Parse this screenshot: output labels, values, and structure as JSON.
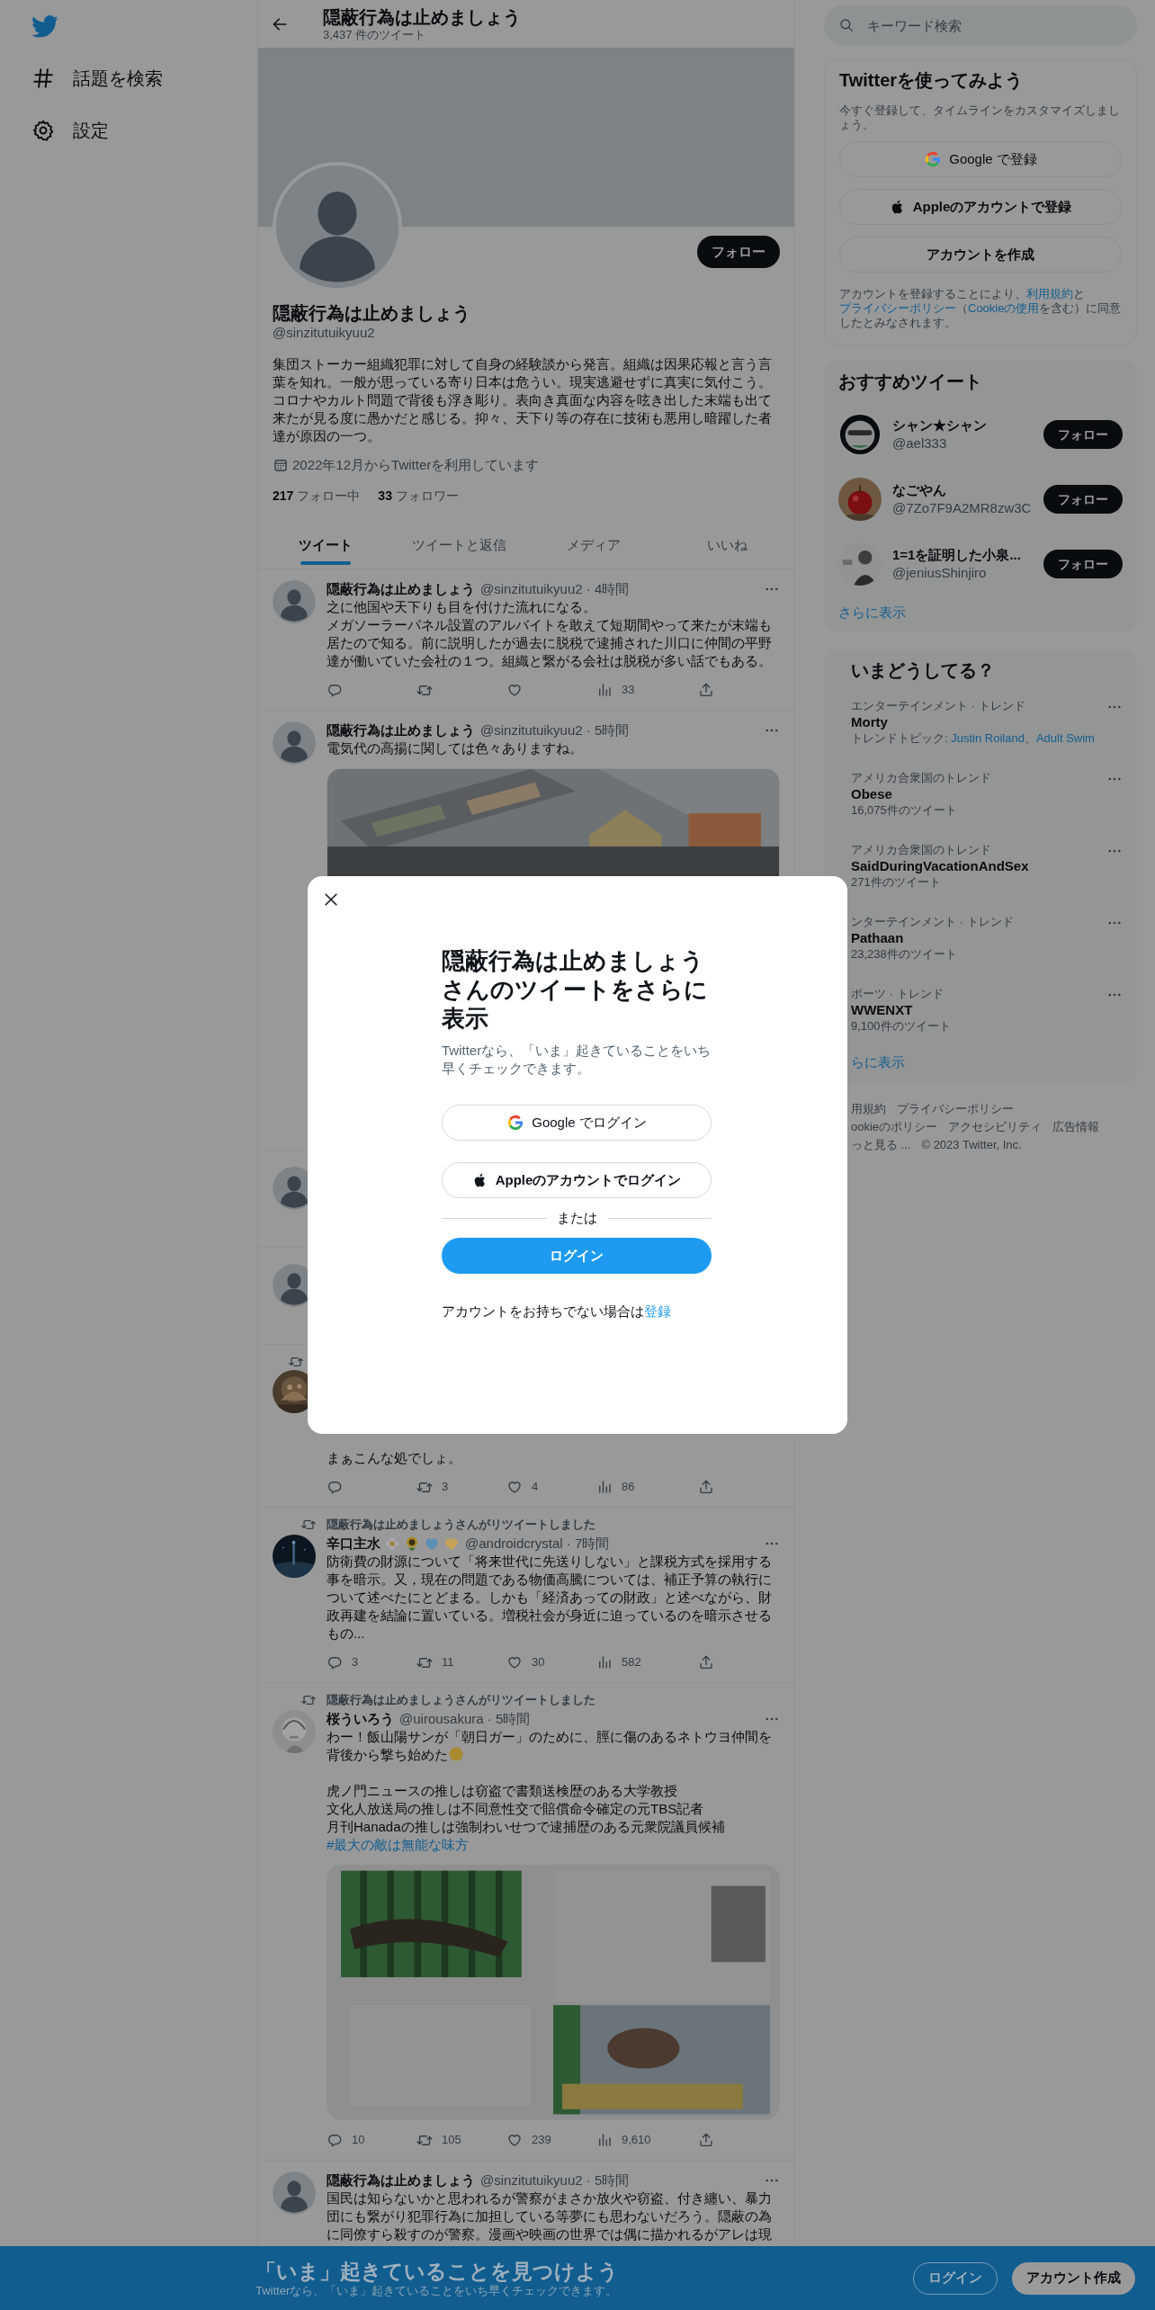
{
  "nav": {
    "items": [
      {
        "label": "話題を検索"
      },
      {
        "label": "設定"
      }
    ]
  },
  "profile_header": {
    "title": "隠蔽行為は止めましょう",
    "subtitle": "3,437 件のツイート"
  },
  "profile": {
    "follow_button": "フォロー",
    "name": "隠蔽行為は止めましょう",
    "handle": "@sinzitutuikyuu2",
    "bio": "集団ストーカー組織犯罪に対して自身の経験談から発言。組織は因果応報と言う言葉を知れ。一般が思っている寄り日本は危うい。現実逃避せずに真実に気付こう。コロナやカルト問題で背後も浮き彫り。表向き真面な内容を呟き出した末端も出て来たが見る度に愚かだと感じる。抑々、天下り等の存在に技術も悪用し暗躍した者達が原因の一つ。",
    "joined": "2022年12月からTwitterを利用しています",
    "following_count": "217",
    "following_label": "フォロー中",
    "followers_count": "33",
    "followers_label": "フォロワー"
  },
  "tabs": [
    {
      "label": "ツイート",
      "selected": true
    },
    {
      "label": "ツイートと返信",
      "selected": false
    },
    {
      "label": "メディア",
      "selected": false
    },
    {
      "label": "いいね",
      "selected": false
    }
  ],
  "tweets": [
    {
      "kind": "tweet",
      "name": "隠蔽行為は止めましょう",
      "meta": "@sinzitutuikyuu2 · 4時間",
      "body": [
        {
          "kind": "text",
          "text": "之に他国や天下りも目を付けた流れになる。"
        },
        {
          "kind": "break"
        },
        {
          "kind": "text",
          "text": "メガソーラーパネル設置のアルバイトを敢えて短期間やって来たが末端も居たので知る。前に説明したが過去に脱税で逮捕された川口に仲間の平野達が働いていた会社の１つ。組織と繋がる会社は脱税が多い話でもある。"
        }
      ],
      "actions": [
        {
          "kind": "reply"
        },
        {
          "kind": "retweet"
        },
        {
          "kind": "like"
        },
        {
          "kind": "views",
          "count": "33"
        },
        {
          "kind": "share"
        }
      ]
    },
    {
      "kind": "tweet",
      "name": "隠蔽行為は止めましょう",
      "meta": "@sinzitutuikyuu2 · 5時間",
      "body": [
        {
          "kind": "text",
          "text": "電気代の高揚に関しては色々ありますね。"
        }
      ],
      "media": {
        "kind": "picture"
      }
    },
    {
      "kind": "covered"
    },
    {
      "kind": "covered"
    },
    {
      "kind": "partial",
      "body": [
        {
          "kind": "text",
          "text": "まぁこんな処でしょ。"
        }
      ],
      "actions": [
        {
          "kind": "reply"
        },
        {
          "kind": "retweet",
          "count": "3"
        },
        {
          "kind": "like",
          "count": "4"
        },
        {
          "kind": "views",
          "count": "86"
        },
        {
          "kind": "share"
        }
      ]
    },
    {
      "kind": "tweet",
      "retweeted_by": "隠蔽行為は止めましょうさんがリツイートしました",
      "name": "辛口主水",
      "badges": [
        {
          "kind": "flower"
        },
        {
          "kind": "sunflower"
        },
        {
          "kind": "heart",
          "color": "#5b8fb5"
        },
        {
          "kind": "heart",
          "color": "#c9a35a"
        }
      ],
      "meta": "@androidcrystal · 7時間",
      "body": [
        {
          "kind": "text",
          "text": "防衛費の財源について「将来世代に先送りしない」と課税方式を採用する事を暗示。又，現在の問題である物価高騰については、補正予算の執行について述べたにとどまる。しかも「経済あっての財政」と述べながら、財政再建を結論に置いている。増税社会が身近に迫っているのを暗示させるもの..."
        }
      ],
      "actions": [
        {
          "kind": "reply",
          "count": "3"
        },
        {
          "kind": "retweet",
          "count": "11"
        },
        {
          "kind": "like",
          "count": "30"
        },
        {
          "kind": "views",
          "count": "582"
        },
        {
          "kind": "share"
        }
      ]
    },
    {
      "kind": "tweet",
      "retweeted_by": "隠蔽行為は止めましょうさんがリツイートしました",
      "name": "桜ういろう",
      "meta": "@uirousakura · 5時間",
      "body": [
        {
          "kind": "text",
          "text": "わー！飯山陽サンが「朝日ガー」のために、脛に傷のあるネトウヨ仲間を背後から撃ち始めた"
        },
        {
          "kind": "emoji"
        },
        {
          "kind": "break"
        },
        {
          "kind": "break"
        },
        {
          "kind": "text",
          "text": "虎ノ門ニュースの推しは窃盗で書類送検歴のある大学教授"
        },
        {
          "kind": "break"
        },
        {
          "kind": "text",
          "text": "文化人放送局の推しは不同意性交で賠償命令確定の元TBS記者"
        },
        {
          "kind": "break"
        },
        {
          "kind": "text",
          "text": "月刊Hanadaの推しは強制わいせつで逮捕歴のある元衆院議員候補"
        },
        {
          "kind": "break"
        },
        {
          "kind": "hashtag",
          "text": "#最大の敵は無能な味方"
        }
      ],
      "media": {
        "kind": "picture"
      },
      "actions": [
        {
          "kind": "reply",
          "count": "10"
        },
        {
          "kind": "retweet",
          "count": "105"
        },
        {
          "kind": "like",
          "count": "239"
        },
        {
          "kind": "views",
          "count": "9,610"
        },
        {
          "kind": "share"
        }
      ]
    },
    {
      "kind": "tweet",
      "name": "隠蔽行為は止めましょう",
      "meta": "@sinzitutuikyuu2 · 5時間",
      "body": [
        {
          "kind": "text",
          "text": "国民は知らないかと思われるが警察がまさか放火や窃盗、付き纏い、暴力団にも繋がり犯罪行為に加担している等夢にも思わないだろう。隠蔽の為に同僚すら殺すのが警察。漫画や映画の世界では偶に描かれるがアレは現"
        }
      ]
    }
  ],
  "sidebar": {
    "search": {
      "placeholder": "キーワード検索"
    },
    "signup": {
      "title": "Twitterを使ってみよう",
      "subtitle": "今すぐ登録して、タイムラインをカスタマイズしましょう。",
      "buttons": [
        {
          "kind": "google",
          "label": "Google で登録"
        },
        {
          "kind": "apple",
          "label": "Appleのアカウントで登録"
        },
        {
          "kind": "plain",
          "label": "アカウントを作成"
        }
      ],
      "legal": [
        {
          "text": "アカウントを登録することにより、",
          "link": false
        },
        {
          "text": "利用規約",
          "link": true
        },
        {
          "text": "と",
          "link": false
        },
        {
          "text": "プライバシーポリシー",
          "link": true
        },
        {
          "text": "（",
          "link": false
        },
        {
          "text": "Cookieの使用",
          "link": true
        },
        {
          "text": "を含む）に同意したとみなされます。",
          "link": false
        }
      ]
    },
    "suggestions": {
      "title": "おすすめツイート",
      "accounts": [
        {
          "name": "シャン★シャン",
          "handle": "@ael333",
          "button": "フォロー"
        },
        {
          "name": "なごやん",
          "handle": "@7Zo7F9A2MR8zw3C",
          "button": "フォロー"
        },
        {
          "name": "1=1を証明した小泉...",
          "handle": "@jeniusShinjiro",
          "button": "フォロー"
        }
      ],
      "more": "さらに表示"
    },
    "trends": {
      "title": "いまどうしてる？",
      "items": [
        {
          "category": "エンターテインメント · トレンド",
          "name": "Morty",
          "topics": {
            "label": "トレンドトピック:",
            "links": [
              "Justin Roiland",
              "Adult Swim"
            ],
            "separator": "、"
          }
        },
        {
          "category": "アメリカ合衆国のトレンド",
          "name": "Obese",
          "count": "16,075件のツイート"
        },
        {
          "category": "アメリカ合衆国のトレンド",
          "name": "SaidDuringVacationAndSex",
          "count": "271件のツイート"
        },
        {
          "category": "ンターテインメント · トレンド",
          "name": "Pathaan",
          "count": "23,238件のツイート"
        },
        {
          "category": "ポーツ · トレンド",
          "name": "WWENXT",
          "count": "9,100件のツイート"
        }
      ],
      "more": "らに表示"
    },
    "footer": [
      [
        "用規約",
        "プライバシーポリシー"
      ],
      [
        "ookieのポリシー",
        "アクセシビリティ",
        "広告情報"
      ],
      [
        "っと見る ...",
        "© 2023 Twitter, Inc."
      ]
    ]
  },
  "modal": {
    "title": "隠蔽行為は止めましょうさんのツイートをさらに表示",
    "subtitle": "Twitterなら、「いま」起きていることをいち早くチェックできます。",
    "buttons": [
      {
        "kind": "google",
        "label": "Google でログイン"
      },
      {
        "kind": "apple",
        "label": "Appleのアカウントでログイン"
      }
    ],
    "divider": "または",
    "login": "ログイン",
    "signup_prompt": "アカウントをお持ちでない場合は",
    "signup_link": "登録"
  },
  "bottom_bar": {
    "title": "「いま」起きていることを見つけよう",
    "subtitle": "Twitterなら、「いま」起きていることをいち早くチェックできます。",
    "buttons": [
      {
        "kind": "outline",
        "label": "ログイン"
      },
      {
        "kind": "filled",
        "label": "アカウント作成"
      }
    ]
  }
}
